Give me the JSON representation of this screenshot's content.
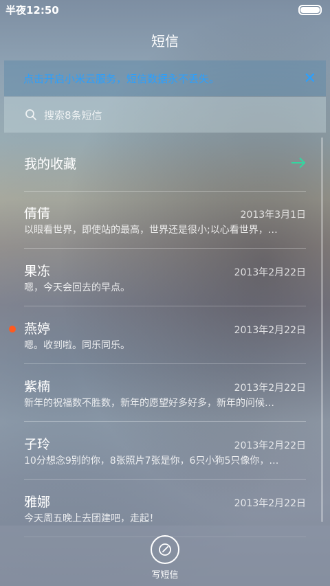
{
  "status": {
    "time": "半夜12:50"
  },
  "header": {
    "title": "短信"
  },
  "banner": {
    "text": "点击开启小米云服务，短信数据永不丢失。",
    "close": "✕"
  },
  "search": {
    "placeholder": "搜索8条短信"
  },
  "favorites": {
    "label": "我的收藏"
  },
  "messages": [
    {
      "name": "倩倩",
      "date": "2013年3月1日",
      "preview": "以眼看世界，即使站的最高，世界还是很小;以心看世界，…",
      "unread": false
    },
    {
      "name": "果冻",
      "date": "2013年2月22日",
      "preview": "嗯，今天会回去的早点。",
      "unread": false
    },
    {
      "name": "燕婷",
      "date": "2013年2月22日",
      "preview": "嗯。收到啦。同乐同乐。",
      "unread": true
    },
    {
      "name": "紫楠",
      "date": "2013年2月22日",
      "preview": "新年的祝福数不胜数，新年的愿望好多好多，新年的问候…",
      "unread": false
    },
    {
      "name": "子玲",
      "date": "2013年2月22日",
      "preview": "10分想念9别的你，8张照片7张是你，6只小狗5只像你，…",
      "unread": false
    },
    {
      "name": "雅娜",
      "date": "2013年2月22日",
      "preview": "今天周五晚上去团建吧，走起！",
      "unread": false
    }
  ],
  "compose": {
    "label": "写短信"
  },
  "colors": {
    "accent": "#2aa0ff",
    "unread_dot": "#ff5a1f",
    "fav_arrow": "#33d6a0"
  }
}
